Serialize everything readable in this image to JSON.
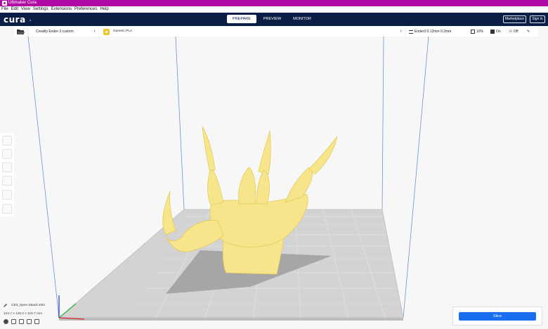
{
  "window": {
    "title": "Ultimaker Cura"
  },
  "menu": {
    "items": [
      "File",
      "Edit",
      "View",
      "Settings",
      "Extensions",
      "Preferences",
      "Help"
    ]
  },
  "header": {
    "logo": "cura",
    "tabs": [
      "PREPARE",
      "PREVIEW",
      "MONITOR"
    ],
    "active_tab": "PREPARE",
    "marketplace_label": "Marketplace",
    "signin_label": "Sign in"
  },
  "toolbar": {
    "printer": "Creality Ender-3 custom",
    "material": "Generic PLA",
    "profile": "Ender3 0.12mm 0.2mm",
    "infill": "10%",
    "support": "On",
    "adhesion": "Off"
  },
  "object": {
    "name": "CE3_Spex-Stand-10m",
    "dimensions": "124.7 x 125.0 x 110.7 mm"
  },
  "action": {
    "slice_label": "Slice"
  },
  "colors": {
    "titlebar": "#b10ba5",
    "header": "#0a1e45",
    "model": "#f5e58a",
    "slice_button": "#196ef0",
    "build_plate": "#cfcfcf"
  }
}
